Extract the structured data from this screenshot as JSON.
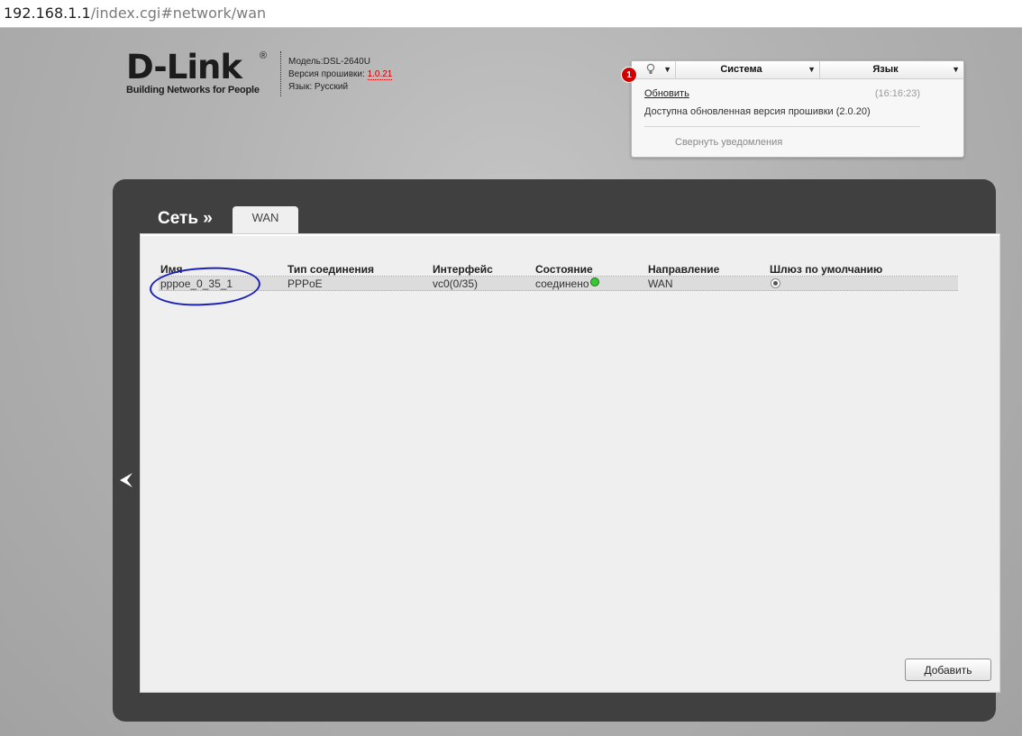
{
  "browser": {
    "url_host": "192.168.1.1",
    "url_path": "/index.cgi#network/wan"
  },
  "header": {
    "brand": "D-Link",
    "reg_mark": "®",
    "tagline": "Building Networks for People",
    "model_label": "Модель:DSL-2640U",
    "firmware_label": "Версия прошивки:",
    "firmware_version": "1.0.21",
    "language_label": "Язык: Русский"
  },
  "notifications": {
    "badge_count": "1",
    "bulb_icon": "lightbulb-icon",
    "system_label": "Система",
    "language_menu_label": "Язык",
    "update_link": "Обновить",
    "update_time": "(16:16:23)",
    "update_message": "Доступна обновленная версия прошивки (2.0.20)",
    "collapse_label": "Свернуть уведомления"
  },
  "page": {
    "breadcrumb": "Сеть »",
    "active_tab": "WAN",
    "back_icon": "back-arrow-icon"
  },
  "table": {
    "headers": [
      "Имя",
      "Тип соединения",
      "Интерфейс",
      "Состояние",
      "Направление",
      "Шлюз по умолчанию"
    ],
    "rows": [
      {
        "name": "pppoe_0_35_1",
        "type": "PPPoE",
        "interface": "vc0(0/35)",
        "status": "соединено",
        "status_color": "#39c739",
        "direction": "WAN",
        "default_gateway": true
      }
    ]
  },
  "actions": {
    "add_label": "Добавить"
  },
  "annotation": {
    "circle_color": "#1a20b8"
  }
}
